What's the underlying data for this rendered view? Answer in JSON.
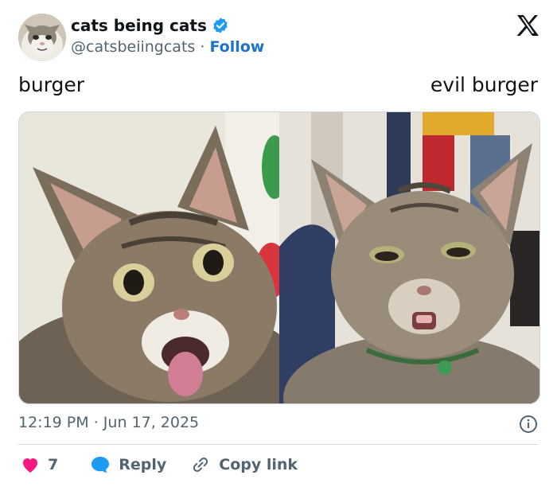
{
  "header": {
    "display_name": "cats being cats",
    "handle": "@catsbeiingcats",
    "separator": "·",
    "follow_label": "Follow",
    "verified_color": "#1d9bf0",
    "logo_icon": "x-logo-icon"
  },
  "post": {
    "caption_left": "burger",
    "caption_right": "evil burger",
    "images": [
      {
        "icon": "cat-photo-surprised"
      },
      {
        "icon": "cat-photo-evil"
      }
    ]
  },
  "meta": {
    "time": "12:19 PM",
    "separator": "·",
    "date": "Jun 17, 2025"
  },
  "actions": {
    "like_count": "7",
    "like_color": "#f91880",
    "reply_label": "Reply",
    "reply_color": "#1d9bf0",
    "copy_label": "Copy link"
  }
}
